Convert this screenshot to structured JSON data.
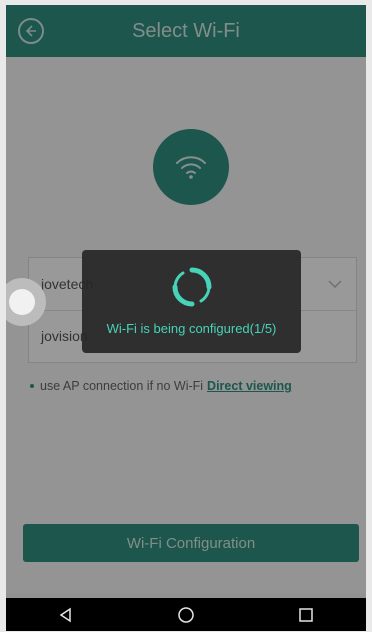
{
  "header": {
    "title": "Select Wi-Fi",
    "back_icon": "back-arrow-circle-icon"
  },
  "main": {
    "wifi_icon": "wifi-icon",
    "network_field": {
      "value": "jovetech",
      "dropdown_icon": "chevron-down-icon"
    },
    "password_field": {
      "value": "jovision"
    },
    "hint": {
      "text": "use AP connection if no Wi-Fi",
      "link": "Direct viewing"
    },
    "config_button": {
      "label": "Wi-Fi Configuration"
    }
  },
  "overlay": {
    "message": "Wi-Fi is being configured(1/5)",
    "spinner_icon": "loading-spinner-icon"
  },
  "colors": {
    "accent": "#2f8f7f",
    "toast_text": "#47d3b8"
  },
  "navbar": {
    "icons": [
      "back-triangle-icon",
      "home-circle-icon",
      "recents-square-icon"
    ]
  }
}
